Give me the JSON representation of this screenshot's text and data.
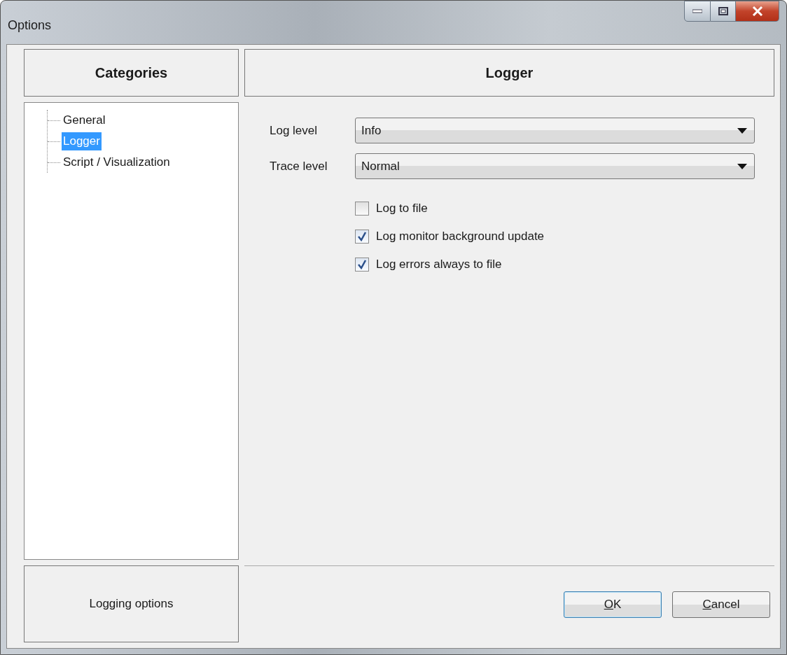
{
  "window": {
    "title": "Options"
  },
  "categories": {
    "header": "Categories",
    "tree": [
      {
        "label": "General",
        "selected": false
      },
      {
        "label": "Logger",
        "selected": true
      },
      {
        "label": "Script / Visualization",
        "selected": false
      }
    ],
    "description": "Logging options"
  },
  "page": {
    "header": "Logger",
    "fields": [
      {
        "label": "Log level",
        "value": "Info"
      },
      {
        "label": "Trace level",
        "value": "Normal"
      }
    ],
    "checkboxes": [
      {
        "label": "Log to file",
        "checked": false
      },
      {
        "label": "Log monitor background update",
        "checked": true
      },
      {
        "label": "Log errors always to file",
        "checked": true
      }
    ]
  },
  "buttons": [
    {
      "label": "OK",
      "default": true,
      "underline_first": true
    },
    {
      "label": "Cancel",
      "default": false,
      "underline_first": true
    }
  ]
}
